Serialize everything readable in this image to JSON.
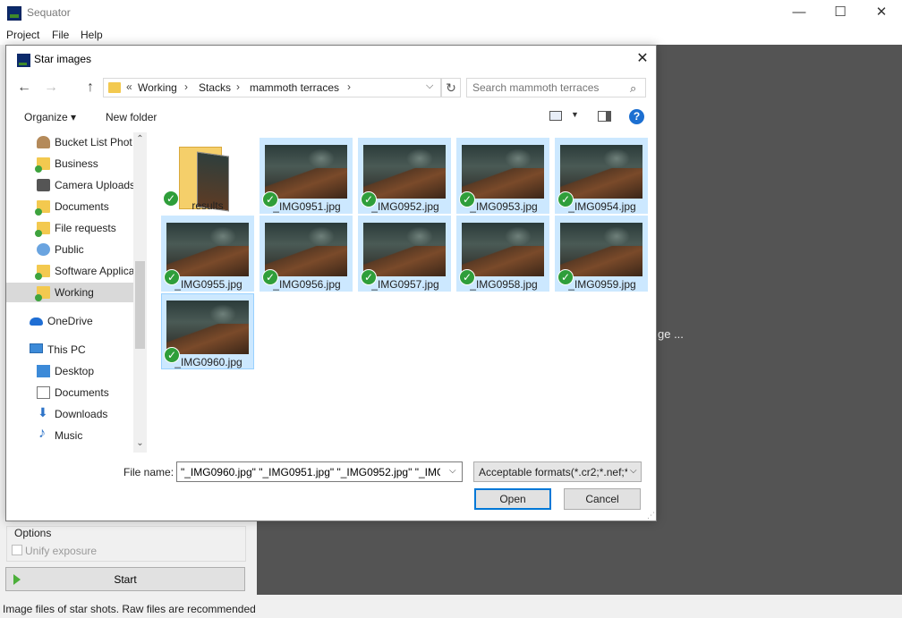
{
  "app": {
    "title": "Sequator",
    "minimize": "—",
    "maximize": "☐",
    "close": "✕",
    "menu": [
      "Project",
      "File",
      "Help"
    ],
    "canvas_message": "ge ...",
    "options_title": "Options",
    "unify_exposure_label": "Unify exposure",
    "start_label": "Start",
    "status_text": "Image files of star shots. Raw files are recommended"
  },
  "dialog": {
    "title": "Star images",
    "close": "✕",
    "nav": {
      "back": "←",
      "forward": "→",
      "up": "↑",
      "refresh": "↻"
    },
    "address": {
      "overflow": "«",
      "crumbs": [
        "Working",
        "Stacks",
        "mammoth terraces"
      ],
      "separator": "›",
      "dropdown": "⌵"
    },
    "search_placeholder": "Search mammoth terraces",
    "search_icon": "⌕",
    "toolbar": {
      "organize": "Organize ▾",
      "new_folder": "New folder",
      "view_dropdown": "▼",
      "help": "?"
    },
    "nav_items": [
      {
        "label": "Bucket List Phot",
        "icon": "people-folder-icon"
      },
      {
        "label": "Business",
        "icon": "synced-folder-icon"
      },
      {
        "label": "Camera Uploads",
        "icon": "camera-folder-icon"
      },
      {
        "label": "Documents",
        "icon": "synced-folder-icon"
      },
      {
        "label": "File requests",
        "icon": "synced-folder-icon"
      },
      {
        "label": "Public",
        "icon": "globe-folder-icon"
      },
      {
        "label": "Software Applica",
        "icon": "synced-folder-icon"
      },
      {
        "label": "Working",
        "icon": "synced-folder-icon",
        "selected": true
      },
      {
        "label": "OneDrive",
        "icon": "onedrive-icon"
      },
      {
        "label": "This PC",
        "icon": "this-pc-icon"
      },
      {
        "label": "Desktop",
        "icon": "desktop-icon"
      },
      {
        "label": "Documents",
        "icon": "documents-icon"
      },
      {
        "label": "Downloads",
        "icon": "downloads-icon"
      },
      {
        "label": "Music",
        "icon": "music-icon"
      }
    ],
    "scroll": {
      "up": "⌃",
      "down": "⌄"
    },
    "files": [
      {
        "name": "results",
        "type": "folder"
      },
      {
        "name": "_IMG0951.jpg",
        "type": "image"
      },
      {
        "name": "_IMG0952.jpg",
        "type": "image"
      },
      {
        "name": "_IMG0953.jpg",
        "type": "image"
      },
      {
        "name": "_IMG0954.jpg",
        "type": "image"
      },
      {
        "name": "_IMG0955.jpg",
        "type": "image"
      },
      {
        "name": "_IMG0956.jpg",
        "type": "image"
      },
      {
        "name": "_IMG0957.jpg",
        "type": "image"
      },
      {
        "name": "_IMG0958.jpg",
        "type": "image"
      },
      {
        "name": "_IMG0959.jpg",
        "type": "image"
      },
      {
        "name": "_IMG0960.jpg",
        "type": "image"
      }
    ],
    "check": "✓",
    "file_name_label": "File name:",
    "file_name_value": "\"_IMG0960.jpg\" \"_IMG0951.jpg\" \"_IMG0952.jpg\" \"_IMG09",
    "file_type_value": "Acceptable formats(*.cr2;*.nef;*",
    "dropdown_glyph": "⌵",
    "open_label": "Open",
    "cancel_label": "Cancel",
    "grip": "⋰"
  }
}
